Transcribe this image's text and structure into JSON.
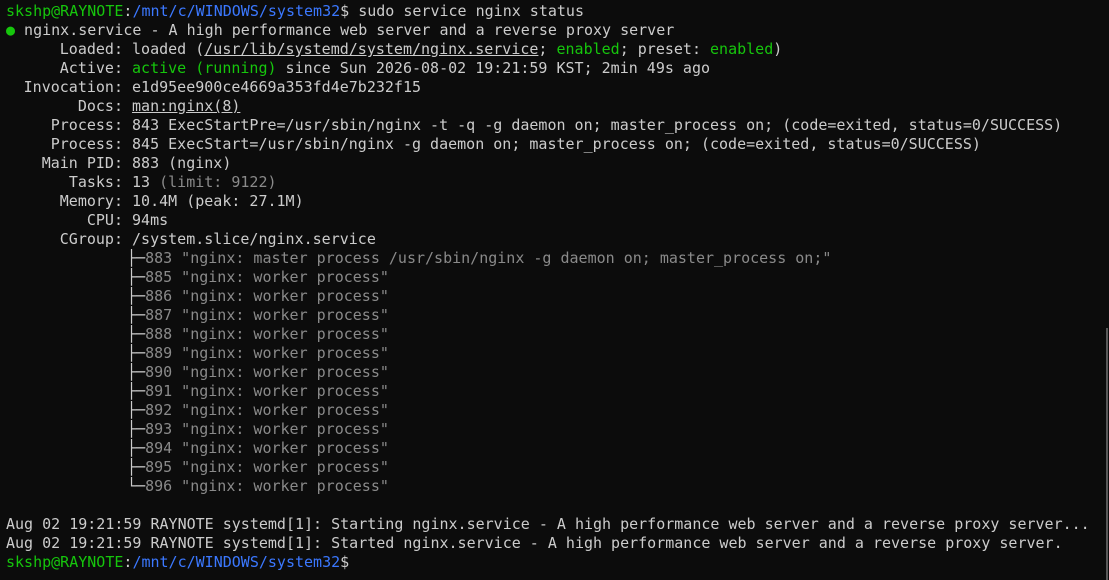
{
  "prompt": {
    "user_host": "skshp@RAYNOTE",
    "colon": ":",
    "path": "/mnt/c/WINDOWS/system32",
    "dollar": "$",
    "command": " sudo service nginx status"
  },
  "service": {
    "bullet": "●",
    "title": " nginx.service - A high performance web server and a reverse proxy server",
    "loaded_label": "Loaded:",
    "loaded_prefix": " loaded (",
    "loaded_path": "/usr/lib/systemd/system/nginx.service",
    "loaded_sep1": "; ",
    "loaded_enabled": "enabled",
    "loaded_sep2": "; preset: ",
    "loaded_preset": "enabled",
    "loaded_close": ")",
    "active_label": "Active:",
    "active_state": "active (running)",
    "active_since": " since Sun 2026-08-02 19:21:59 KST; 2min 49s ago",
    "invocation_label": "Invocation:",
    "invocation_value": " e1d95ee900ce4669a353fd4e7b232f15",
    "docs_label": "Docs:",
    "docs_value": "man:nginx(8)",
    "process_label": "Process:",
    "process_1": " 843 ExecStartPre=/usr/sbin/nginx -t -q -g daemon on; master_process on; (code=exited, status=0/SUCCESS)",
    "process_2": " 845 ExecStart=/usr/sbin/nginx -g daemon on; master_process on; (code=exited, status=0/SUCCESS)",
    "mainpid_label": "Main PID:",
    "mainpid_value": " 883 (nginx)",
    "tasks_label": "Tasks:",
    "tasks_value": " 13 ",
    "tasks_limit": "(limit: 9122)",
    "memory_label": "Memory:",
    "memory_value": " 10.4M (peak: 27.1M)",
    "cpu_label": "CPU:",
    "cpu_value": " 94ms",
    "cgroup_label": "CGroup:",
    "cgroup_value": " /system.slice/nginx.service"
  },
  "tree": [
    {
      "branch": "├─",
      "text": "883 \"nginx: master process /usr/sbin/nginx -g daemon on; master_process on;\""
    },
    {
      "branch": "├─",
      "text": "885 \"nginx: worker process\""
    },
    {
      "branch": "├─",
      "text": "886 \"nginx: worker process\""
    },
    {
      "branch": "├─",
      "text": "887 \"nginx: worker process\""
    },
    {
      "branch": "├─",
      "text": "888 \"nginx: worker process\""
    },
    {
      "branch": "├─",
      "text": "889 \"nginx: worker process\""
    },
    {
      "branch": "├─",
      "text": "890 \"nginx: worker process\""
    },
    {
      "branch": "├─",
      "text": "891 \"nginx: worker process\""
    },
    {
      "branch": "├─",
      "text": "892 \"nginx: worker process\""
    },
    {
      "branch": "├─",
      "text": "893 \"nginx: worker process\""
    },
    {
      "branch": "├─",
      "text": "894 \"nginx: worker process\""
    },
    {
      "branch": "├─",
      "text": "895 \"nginx: worker process\""
    },
    {
      "branch": "└─",
      "text": "896 \"nginx: worker process\""
    }
  ],
  "logs": [
    "Aug 02 19:21:59 RAYNOTE systemd[1]: Starting nginx.service - A high performance web server and a reverse proxy server...",
    "Aug 02 19:21:59 RAYNOTE systemd[1]: Started nginx.service - A high performance web server and a reverse proxy server."
  ],
  "prompt2": {
    "user_host": "skshp@RAYNOTE",
    "colon": ":",
    "path": "/mnt/c/WINDOWS/system32",
    "dollar": "$"
  },
  "colors": {
    "background": "#0c0c0c",
    "foreground": "#cccccc",
    "green": "#16c60c",
    "blue": "#3b78ff",
    "dim": "#8a8a8a"
  }
}
